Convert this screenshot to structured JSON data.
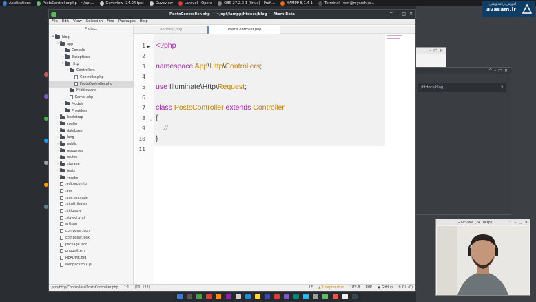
{
  "topbar": {
    "items": [
      {
        "label": "Applications",
        "icon": "apps-icon",
        "color": "#3d7ad6"
      },
      {
        "label": "PostsController.php - ~/opt...",
        "icon": "atom-icon",
        "color": "#66bb6a"
      },
      {
        "label": "Guvcview (24.04 fps)",
        "icon": "camera-icon",
        "color": "#cfcfcf"
      },
      {
        "label": "Guvcview",
        "icon": "camera-icon",
        "color": "#cfcfcf"
      },
      {
        "label": "Laravel - Opera",
        "icon": "opera-icon",
        "color": "#e53935"
      },
      {
        "label": "OBS 27.2.3-1 (linux) - Profi...",
        "icon": "obs-icon",
        "color": "#888888"
      },
      {
        "label": "XAMPP 8.1.4-1",
        "icon": "xampp-icon",
        "color": "#ef6c00"
      },
      {
        "label": "Terminal - wm@myarch:/s...",
        "icon": "terminal-icon",
        "color": "#555555"
      }
    ],
    "keyboard_layout": "US"
  },
  "brand": {
    "text": "avasam.ir"
  },
  "window": {
    "title": "PostsController.php — ~/opt/lampp/htdocs/blog — Atom Beta",
    "menu": [
      "File",
      "Edit",
      "View",
      "Selection",
      "Find",
      "Packages",
      "Help"
    ]
  },
  "tree": {
    "title": "Project",
    "rows": [
      {
        "label": "blog",
        "kind": "folder",
        "depth": 0,
        "arrow": "▾"
      },
      {
        "label": "app",
        "kind": "folder",
        "depth": 1,
        "arrow": "▾"
      },
      {
        "label": "Console",
        "kind": "folder",
        "depth": 2,
        "arrow": "›"
      },
      {
        "label": "Exceptions",
        "kind": "folder",
        "depth": 2,
        "arrow": "›"
      },
      {
        "label": "Http",
        "kind": "folder",
        "depth": 2,
        "arrow": "▾"
      },
      {
        "label": "Controllers",
        "kind": "folder",
        "depth": 3,
        "arrow": "▾"
      },
      {
        "label": "Controller.php",
        "kind": "file",
        "depth": 4,
        "arrow": ""
      },
      {
        "label": "PostsController.php",
        "kind": "file",
        "depth": 4,
        "arrow": "",
        "selected": true
      },
      {
        "label": "Middleware",
        "kind": "folder",
        "depth": 3,
        "arrow": "›"
      },
      {
        "label": "Kernel.php",
        "kind": "file",
        "depth": 3,
        "arrow": ""
      },
      {
        "label": "Models",
        "kind": "folder",
        "depth": 2,
        "arrow": "›"
      },
      {
        "label": "Providers",
        "kind": "folder",
        "depth": 2,
        "arrow": "›"
      },
      {
        "label": "bootstrap",
        "kind": "folder",
        "depth": 1,
        "arrow": "›"
      },
      {
        "label": "config",
        "kind": "folder",
        "depth": 1,
        "arrow": "›"
      },
      {
        "label": "database",
        "kind": "folder",
        "depth": 1,
        "arrow": "›"
      },
      {
        "label": "lang",
        "kind": "folder",
        "depth": 1,
        "arrow": "›"
      },
      {
        "label": "public",
        "kind": "folder",
        "depth": 1,
        "arrow": "›"
      },
      {
        "label": "resources",
        "kind": "folder",
        "depth": 1,
        "arrow": "›"
      },
      {
        "label": "routes",
        "kind": "folder",
        "depth": 1,
        "arrow": "›"
      },
      {
        "label": "storage",
        "kind": "folder",
        "depth": 1,
        "arrow": "›"
      },
      {
        "label": "tests",
        "kind": "folder",
        "depth": 1,
        "arrow": "›"
      },
      {
        "label": "vendor",
        "kind": "folder",
        "depth": 1,
        "arrow": "›"
      },
      {
        "label": ".editorconfig",
        "kind": "file",
        "depth": 1,
        "arrow": ""
      },
      {
        "label": ".env",
        "kind": "file",
        "depth": 1,
        "arrow": ""
      },
      {
        "label": ".env.example",
        "kind": "file",
        "depth": 1,
        "arrow": ""
      },
      {
        "label": ".gitattributes",
        "kind": "file",
        "depth": 1,
        "arrow": ""
      },
      {
        "label": ".gitignore",
        "kind": "file",
        "depth": 1,
        "arrow": ""
      },
      {
        "label": ".styleci.yml",
        "kind": "file",
        "depth": 1,
        "arrow": ""
      },
      {
        "label": "artisan",
        "kind": "file",
        "depth": 1,
        "arrow": ""
      },
      {
        "label": "composer.json",
        "kind": "file",
        "depth": 1,
        "arrow": ""
      },
      {
        "label": "composer.lock",
        "kind": "file",
        "depth": 1,
        "arrow": ""
      },
      {
        "label": "package.json",
        "kind": "file",
        "depth": 1,
        "arrow": ""
      },
      {
        "label": "phpunit.xml",
        "kind": "file",
        "depth": 1,
        "arrow": ""
      },
      {
        "label": "README.md",
        "kind": "file",
        "depth": 1,
        "arrow": ""
      },
      {
        "label": "webpack.mix.js",
        "kind": "file",
        "depth": 1,
        "arrow": ""
      }
    ]
  },
  "tabs": [
    {
      "label": "Controller.php",
      "active": false
    },
    {
      "label": "PostsController.php",
      "active": true
    }
  ],
  "editor": {
    "lines": [
      {
        "n": "1",
        "tokens": [
          {
            "t": "<?php",
            "c": "k"
          }
        ]
      },
      {
        "n": "2",
        "tokens": []
      },
      {
        "n": "3",
        "tokens": [
          {
            "t": "namespace ",
            "c": "k"
          },
          {
            "t": "App",
            "c": "c"
          },
          {
            "t": "\\",
            "c": ""
          },
          {
            "t": "Http",
            "c": "c"
          },
          {
            "t": "\\",
            "c": ""
          },
          {
            "t": "Controllers",
            "c": "c"
          },
          {
            "t": ";",
            "c": ""
          }
        ]
      },
      {
        "n": "4",
        "tokens": []
      },
      {
        "n": "5",
        "tokens": [
          {
            "t": "use ",
            "c": "k"
          },
          {
            "t": "Illuminate\\Http\\",
            "c": ""
          },
          {
            "t": "Request",
            "c": "c"
          },
          {
            "t": ";",
            "c": ""
          }
        ]
      },
      {
        "n": "6",
        "tokens": []
      },
      {
        "n": "7",
        "tokens": [
          {
            "t": "class ",
            "c": "k"
          },
          {
            "t": "PostsController ",
            "c": "c"
          },
          {
            "t": "extends ",
            "c": "k"
          },
          {
            "t": "Controller",
            "c": "c"
          }
        ]
      },
      {
        "n": "8",
        "tokens": [
          {
            "t": "{",
            "c": ""
          }
        ]
      },
      {
        "n": "9",
        "tokens": [
          {
            "t": "    //",
            "c": "cm"
          }
        ]
      },
      {
        "n": "10",
        "tokens": [
          {
            "t": "}",
            "c": ""
          }
        ]
      },
      {
        "n": "11",
        "tokens": []
      }
    ]
  },
  "status": {
    "path": "app/Http/Controllers/PostsController.php",
    "cursor": "1:1",
    "selection": "(10, 122)",
    "line_ending": "LF",
    "deprecations": "1 deprecation",
    "encoding": "UTF-8",
    "grammar": "PHP",
    "github": "GitHub",
    "git": "Git (0)"
  },
  "bg_window": {
    "path": "/htdocs/blog"
  },
  "cam": {
    "title": "Guvcview (24.04 fps)"
  },
  "dock": {
    "colors": [
      "#3d7ad6",
      "#555555",
      "#43a047",
      "#e53935",
      "#fb8c00",
      "#8e24aa",
      "#cfcfcf",
      "#1e88e5",
      "#fdd835",
      "#3949ab",
      "#e53935",
      "#7e57c2",
      "#00897b",
      "#29b6f6",
      "#9e9e9e",
      "#66bb6a",
      "#ef5350",
      "#eeeeee",
      "#37474f"
    ]
  }
}
